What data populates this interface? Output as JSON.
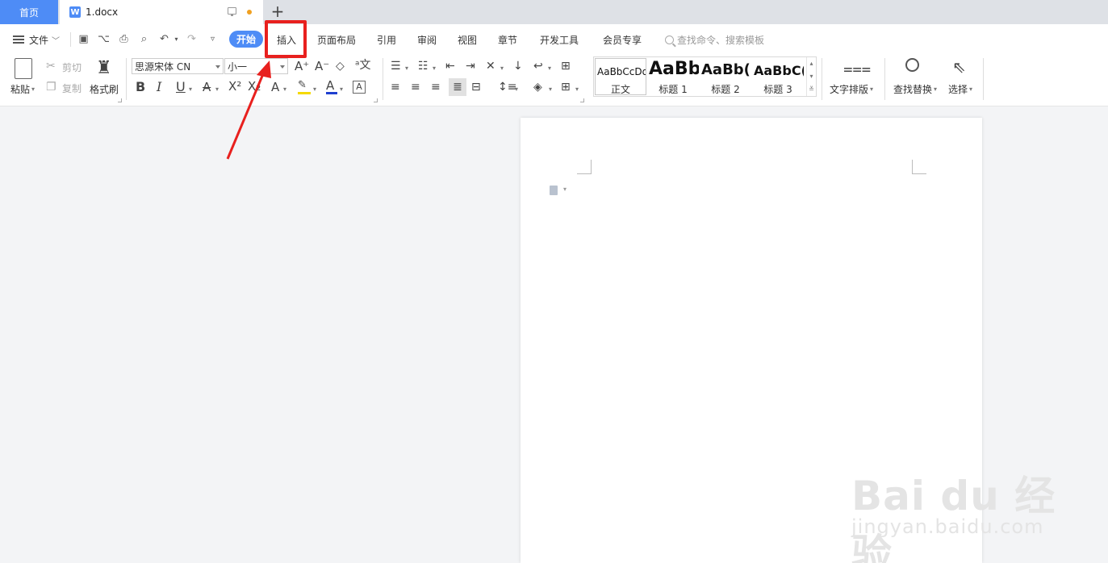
{
  "tabs": {
    "home": "首页",
    "doc_title": "1.docx",
    "add": "+"
  },
  "menu": {
    "file": "文件",
    "start": "开始",
    "items": [
      "插入",
      "页面布局",
      "引用",
      "审阅",
      "视图",
      "章节",
      "开发工具",
      "会员专享"
    ],
    "search_placeholder": "查找命令、搜索模板"
  },
  "ribbon": {
    "paste": "粘贴",
    "cut": "剪切",
    "copy": "复制",
    "format_painter": "格式刷",
    "font_name": "思源宋体 CN",
    "font_size": "小一",
    "bold": "B",
    "italic": "I",
    "underline": "U",
    "text_layout": "文字排版",
    "find_replace": "查找替换",
    "select": "选择"
  },
  "styles": [
    {
      "preview": "AaBbCcDd",
      "label": "正文"
    },
    {
      "preview": "AaBb",
      "label": "标题 1"
    },
    {
      "preview": "AaBb(",
      "label": "标题 2"
    },
    {
      "preview": "AaBbC(",
      "label": "标题 3"
    }
  ],
  "watermark": {
    "main": "Bai du 经验",
    "sub": "jingyan.baidu.com"
  },
  "colors": {
    "accent": "#4e8cf6",
    "annotation": "#e8201e",
    "highlight": "#f5d900",
    "font_color": "#1f3fd0"
  }
}
